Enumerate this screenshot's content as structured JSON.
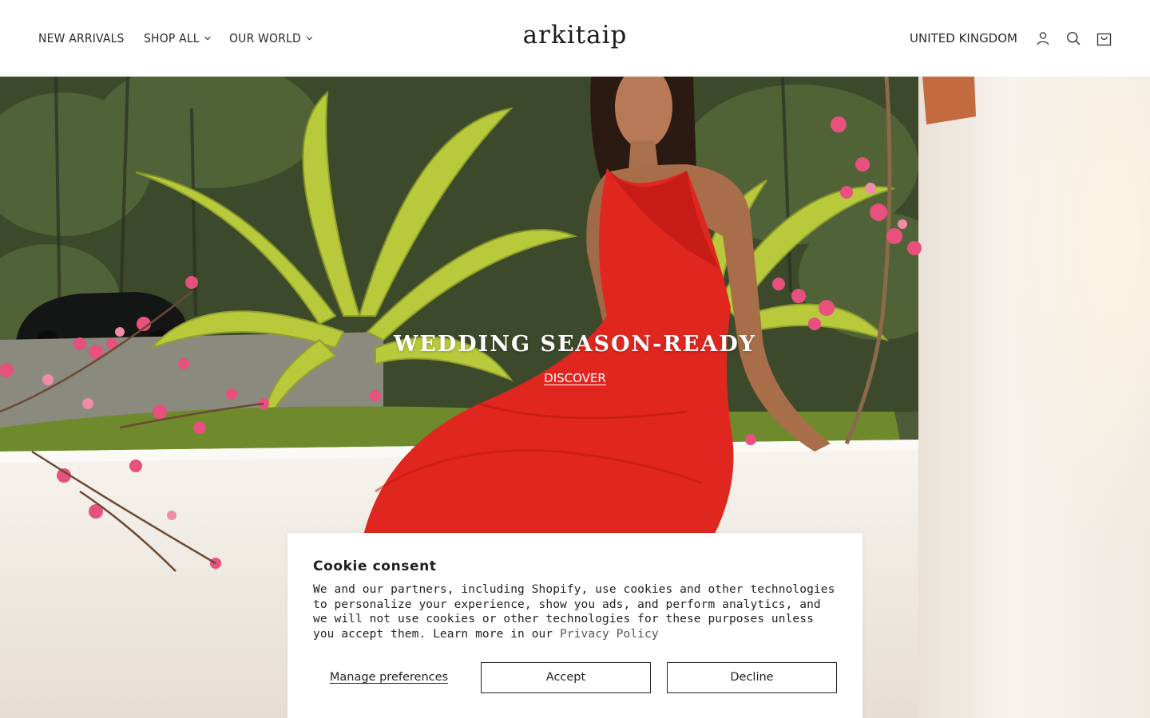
{
  "header": {
    "nav": [
      {
        "label": "NEW ARRIVALS",
        "has_dropdown": false
      },
      {
        "label": "SHOP ALL",
        "has_dropdown": true
      },
      {
        "label": "OUR WORLD",
        "has_dropdown": true
      }
    ],
    "logo": "arkitaip",
    "country": "UNITED KINGDOM",
    "icons": [
      "account-icon",
      "search-icon",
      "cart-icon"
    ]
  },
  "hero": {
    "title": "WEDDING SEASON-READY",
    "link": "DISCOVER"
  },
  "cookie": {
    "title": "Cookie consent",
    "text": "We and our partners, including Shopify, use cookies and other technologies to personalize your experience, show you ads, and perform analytics, and we will not use cookies or other technologies for these purposes unless you accept them. Learn more in our ",
    "privacy_link": "Privacy Policy",
    "manage_label": "Manage preferences",
    "accept_label": "Accept",
    "decline_label": "Decline"
  },
  "colors": {
    "text": "#222222",
    "dress": "#e0271f",
    "palm": "#b9c93c",
    "wall": "#f1ede8",
    "flower": "#e8507e"
  }
}
